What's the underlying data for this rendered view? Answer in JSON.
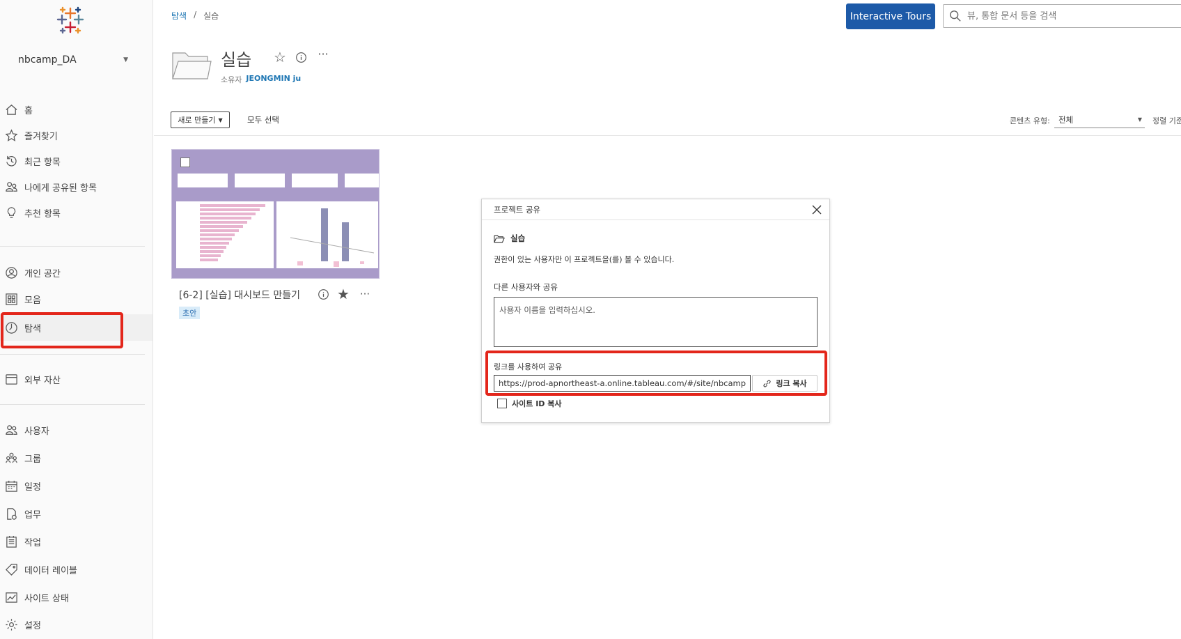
{
  "sidebar": {
    "site_name": "nbcamp_DA",
    "items": [
      {
        "label": "홈",
        "icon": "home-icon"
      },
      {
        "label": "즐겨찾기",
        "icon": "star-icon"
      },
      {
        "label": "최근 항목",
        "icon": "history-icon"
      },
      {
        "label": "나에게 공유된 항목",
        "icon": "shared-users-icon"
      },
      {
        "label": "추천 항목",
        "icon": "lightbulb-icon"
      },
      {
        "label": "개인 공간",
        "icon": "person-icon"
      },
      {
        "label": "모음",
        "icon": "collection-icon"
      },
      {
        "label": "탐색",
        "icon": "compass-icon"
      },
      {
        "label": "외부 자산",
        "icon": "external-assets-icon"
      },
      {
        "label": "사용자",
        "icon": "users-icon"
      },
      {
        "label": "그룹",
        "icon": "groups-icon"
      },
      {
        "label": "일정",
        "icon": "calendar-icon"
      },
      {
        "label": "업무",
        "icon": "tasks-icon"
      },
      {
        "label": "작업",
        "icon": "jobs-icon"
      },
      {
        "label": "데이터 레이블",
        "icon": "tag-icon"
      },
      {
        "label": "사이트 상태",
        "icon": "site-status-icon"
      },
      {
        "label": "설정",
        "icon": "gear-icon"
      }
    ],
    "active_item": "탐색"
  },
  "breadcrumb": {
    "root": "탐색",
    "separator": "/",
    "current": "실습"
  },
  "header": {
    "tours_button": "Interactive Tours",
    "search_placeholder": "뷰, 통합 문서 등을 검색"
  },
  "project": {
    "title": "실습",
    "owner_label": "소유자",
    "owner_name": "JEONGMIN ju"
  },
  "toolbar": {
    "new_button": "새로 만들기",
    "select_all": "모두 선택",
    "content_type_label": "콘텐츠 유형:",
    "content_type_value": "전체",
    "sort_label": "정렬 기준"
  },
  "workbook": {
    "title": "[6-2] [실습] 대시보드 만들기",
    "badge": "초안"
  },
  "dialog": {
    "title": "프로젝트 공유",
    "project_name": "실습",
    "description": "권한이 있는 사용자만 이 프로젝트을(를) 볼 수 있습니다.",
    "share_with_label": "다른 사용자와 공유",
    "user_placeholder": "사용자 이름을 입력하십시오.",
    "link_label": "링크를 사용하여 공유",
    "link_value": "https://prod-apnortheast-a.online.tableau.com/#/site/nbcampd",
    "copy_link_button": "링크 복사",
    "copy_site_id": "사이트 ID 복사"
  },
  "colors": {
    "accent": "#1d5aa8",
    "highlight": "#e3261b",
    "link": "#1f77b4",
    "thumbnail": "#a99bc9"
  }
}
